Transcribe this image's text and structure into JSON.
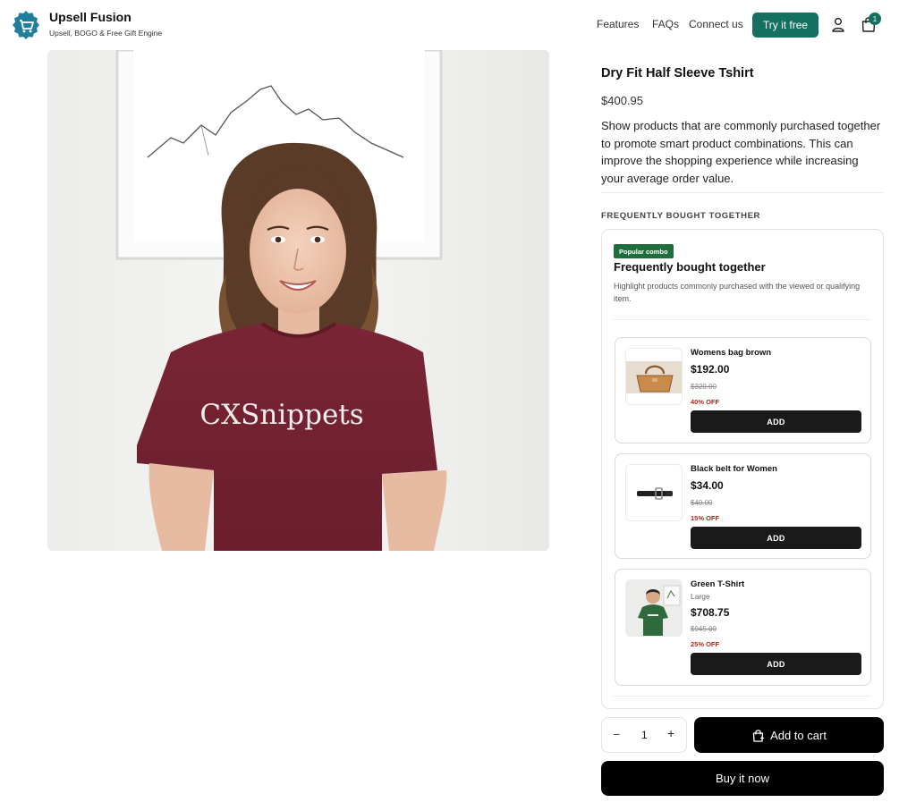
{
  "header": {
    "brand_name": "Upsell Fusion",
    "brand_tagline": "Upsell, BOGO & Free Gift Engine",
    "nav": [
      "Features",
      "FAQs",
      "Connect us"
    ],
    "cta_label": "Try it free",
    "cart_count": "1",
    "accent_color": "#14705f"
  },
  "hero": {
    "shirt_print": "CXSnippets"
  },
  "product": {
    "title": "Dry Fit Half Sleeve Tshirt",
    "price": "$400.95",
    "description": "Show products that are commonly purchased together to promote smart product combinations. This can improve the shopping experience while increasing your average order value."
  },
  "fbt": {
    "section_heading": "FREQUENTLY BOUGHT TOGETHER",
    "badge": "Popular combo",
    "title": "Frequently bought together",
    "subtitle": "Highlight products commonly purchased with the viewed or qualifying item.",
    "items": [
      {
        "name": "Womens bag brown",
        "variant": "",
        "price": "$192.00",
        "compare": "$320.00",
        "discount": "40% OFF",
        "add_label": "ADD",
        "thumb_icon": "handbag-icon"
      },
      {
        "name": "Black belt for Women",
        "variant": "",
        "price": "$34.00",
        "compare": "$40.00",
        "discount": "15% OFF",
        "add_label": "ADD",
        "thumb_icon": "belt-icon"
      },
      {
        "name": "Green T-Shirt",
        "variant": "Large",
        "price": "$708.75",
        "compare": "$945.00",
        "discount": "25% OFF",
        "add_label": "ADD",
        "thumb_icon": "green-tshirt-model"
      }
    ]
  },
  "actions": {
    "qty_minus": "−",
    "qty_value": "1",
    "qty_plus": "+",
    "add_to_cart": "Add to cart",
    "buy_now": "Buy it now"
  }
}
